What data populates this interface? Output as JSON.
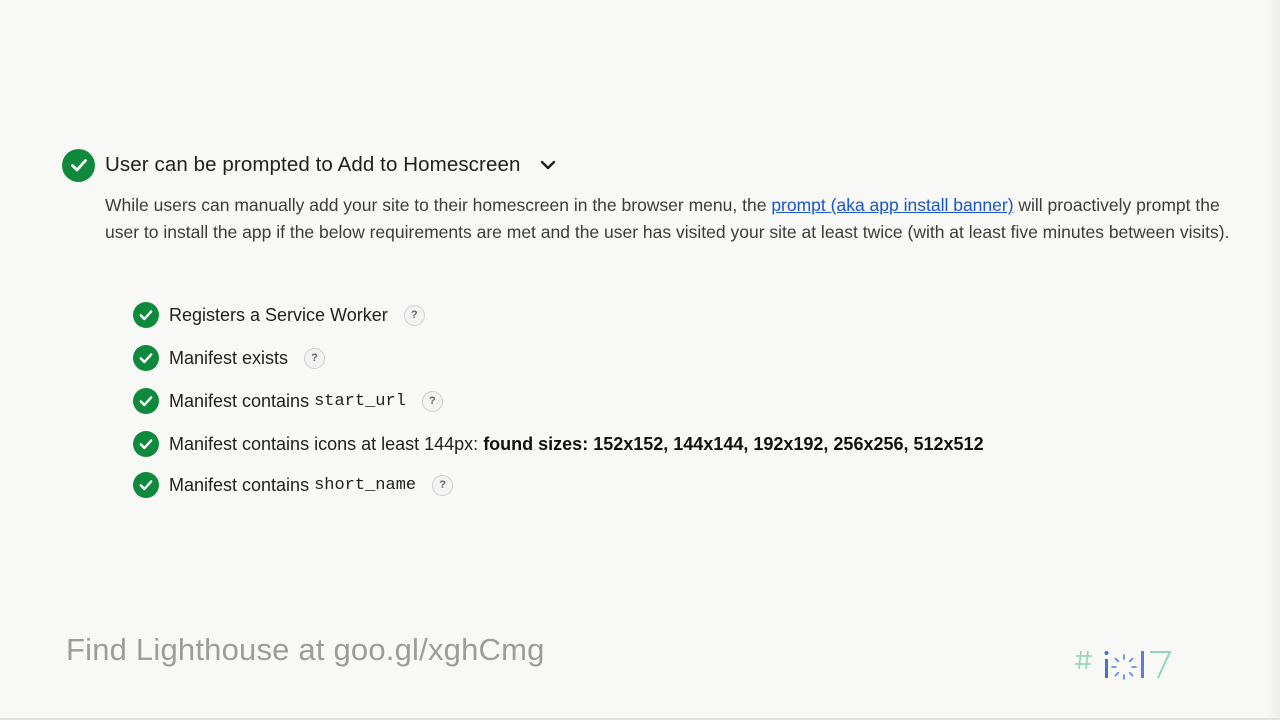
{
  "audit": {
    "title": "User can be prompted to Add to Homescreen",
    "description_before": "While users can manually add your site to their homescreen in the browser menu, the ",
    "link_text": "prompt (aka app install banner)",
    "description_after": " will proactively prompt the user to install the app if the below requirements are met and the user has visited your site at least twice (with at least five minutes between visits).",
    "status_color": "#0f8a3c"
  },
  "checks": [
    {
      "label": "Registers a Service Worker",
      "code": "",
      "detail": "",
      "help": "?"
    },
    {
      "label": "Manifest exists",
      "code": "",
      "detail": "",
      "help": "?"
    },
    {
      "label": "Manifest contains",
      "code": "start_url",
      "detail": "",
      "help": "?"
    },
    {
      "label": "Manifest contains icons at least 144px:",
      "code": "",
      "detail": "found sizes: 152x152, 144x144, 192x192, 256x256, 512x512",
      "help": ""
    },
    {
      "label": "Manifest contains",
      "code": "short_name",
      "detail": "",
      "help": "?"
    }
  ],
  "footer": {
    "text": "Find Lighthouse at goo.gl/xghCmg"
  },
  "icons": {
    "status": "checkmark-icon",
    "expand": "chevron-down-icon",
    "help": "help-icon",
    "logo": "io17-logo"
  },
  "logo_text": "#io17"
}
